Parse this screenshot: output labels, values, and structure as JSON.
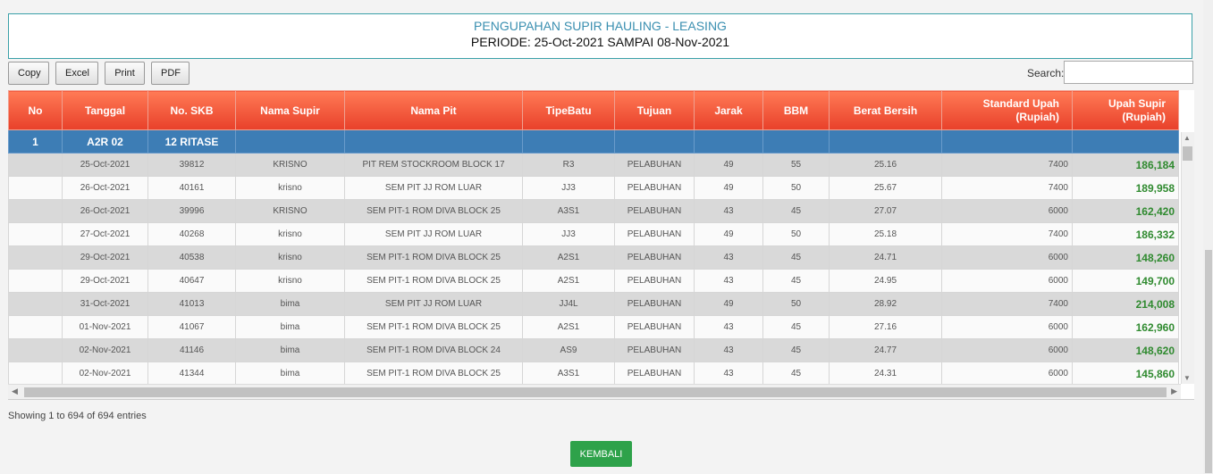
{
  "header": {
    "title": "PENGUPAHAN SUPIR HAULING - LEASING",
    "period": "PERIODE: 25-Oct-2021 SAMPAI 08-Nov-2021"
  },
  "toolbar": {
    "copy": "Copy",
    "excel": "Excel",
    "print": "Print",
    "pdf": "PDF"
  },
  "search": {
    "label": "Search:",
    "value": ""
  },
  "table": {
    "columns": [
      "No",
      "Tanggal",
      "No. SKB",
      "Nama Supir",
      "Nama Pit",
      "TipeBatu",
      "Tujuan",
      "Jarak",
      "BBM",
      "Berat Bersih",
      "Standard Upah (Rupiah)",
      "Upah Supir (Rupiah)"
    ],
    "group": {
      "no": "1",
      "tanggal": "A2R 02",
      "skb": "12 RITASE"
    },
    "rows": [
      [
        "",
        "25-Oct-2021",
        "39812",
        "KRISNO",
        "PIT REM STOCKROOM BLOCK 17",
        "R3",
        "PELABUHAN",
        "49",
        "55",
        "25.16",
        "7400",
        "186,184"
      ],
      [
        "",
        "26-Oct-2021",
        "40161",
        "krisno",
        "SEM PIT JJ ROM LUAR",
        "JJ3",
        "PELABUHAN",
        "49",
        "50",
        "25.67",
        "7400",
        "189,958"
      ],
      [
        "",
        "26-Oct-2021",
        "39996",
        "KRISNO",
        "SEM PIT-1 ROM DIVA BLOCK 25",
        "A3S1",
        "PELABUHAN",
        "43",
        "45",
        "27.07",
        "6000",
        "162,420"
      ],
      [
        "",
        "27-Oct-2021",
        "40268",
        "krisno",
        "SEM PIT JJ ROM LUAR",
        "JJ3",
        "PELABUHAN",
        "49",
        "50",
        "25.18",
        "7400",
        "186,332"
      ],
      [
        "",
        "29-Oct-2021",
        "40538",
        "krisno",
        "SEM PIT-1 ROM DIVA BLOCK 25",
        "A2S1",
        "PELABUHAN",
        "43",
        "45",
        "24.71",
        "6000",
        "148,260"
      ],
      [
        "",
        "29-Oct-2021",
        "40647",
        "krisno",
        "SEM PIT-1 ROM DIVA BLOCK 25",
        "A2S1",
        "PELABUHAN",
        "43",
        "45",
        "24.95",
        "6000",
        "149,700"
      ],
      [
        "",
        "31-Oct-2021",
        "41013",
        "bima",
        "SEM PIT JJ ROM LUAR",
        "JJ4L",
        "PELABUHAN",
        "49",
        "50",
        "28.92",
        "7400",
        "214,008"
      ],
      [
        "",
        "01-Nov-2021",
        "41067",
        "bima",
        "SEM PIT-1 ROM DIVA BLOCK 25",
        "A2S1",
        "PELABUHAN",
        "43",
        "45",
        "27.16",
        "6000",
        "162,960"
      ],
      [
        "",
        "02-Nov-2021",
        "41146",
        "bima",
        "SEM PIT-1 ROM DIVA BLOCK 24",
        "AS9",
        "PELABUHAN",
        "43",
        "45",
        "24.77",
        "6000",
        "148,620"
      ],
      [
        "",
        "02-Nov-2021",
        "41344",
        "bima",
        "SEM PIT-1 ROM DIVA BLOCK 25",
        "A3S1",
        "PELABUHAN",
        "43",
        "45",
        "24.31",
        "6000",
        "145,860"
      ]
    ]
  },
  "info": "Showing 1 to 694 of 694 entries",
  "back_button": "KEMBALI",
  "colors": {
    "header_red": "#e8402a",
    "group_blue": "#3d7db5",
    "upah_green": "#2f8a2f",
    "button_green": "#2ea24a"
  }
}
